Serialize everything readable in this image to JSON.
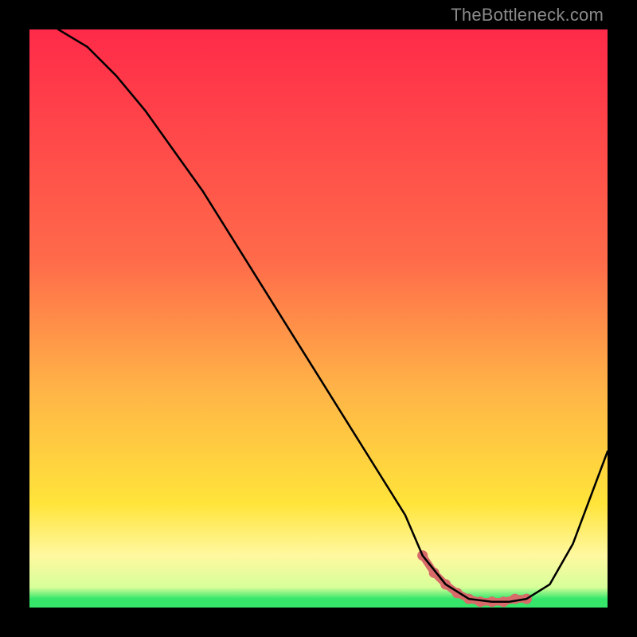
{
  "watermark": "TheBottleneck.com",
  "colors": {
    "band_red": "#ff2a49",
    "band_top_mid": "#ff6b4a",
    "band_mid": "#ffb347",
    "band_yellow": "#ffe43a",
    "band_pale": "#fff8a0",
    "band_green": "#35e66a",
    "curve": "#000000",
    "marker": "#d86a6a",
    "marker_stroke": "#d86a6a"
  },
  "chart_data": {
    "type": "line",
    "title": "",
    "xlabel": "",
    "ylabel": "",
    "xlim": [
      0,
      100
    ],
    "ylim": [
      0,
      100
    ],
    "series": [
      {
        "name": "bottleneck-curve",
        "x": [
          5,
          10,
          15,
          20,
          25,
          30,
          35,
          40,
          45,
          50,
          55,
          60,
          65,
          68,
          72,
          76,
          80,
          83,
          86,
          90,
          94,
          100
        ],
        "values": [
          100,
          97,
          92,
          86,
          79,
          72,
          64,
          56,
          48,
          40,
          32,
          24,
          16,
          9,
          4,
          1.5,
          1,
          1,
          1.5,
          4,
          11,
          27
        ]
      }
    ],
    "markers": {
      "name": "highlight-range",
      "x": [
        68,
        70,
        72,
        74,
        76,
        78,
        80,
        82,
        84,
        86
      ],
      "values": [
        9,
        6,
        4,
        2.5,
        1.5,
        1,
        1,
        1,
        1.5,
        1.5
      ]
    },
    "background_bands": [
      {
        "from_y": 100,
        "to_y": 45,
        "color_top": "#ff2a49",
        "color_bottom": "#ff6b4a"
      },
      {
        "from_y": 45,
        "to_y": 20,
        "color_top": "#ff6b4a",
        "color_bottom": "#ffe43a"
      },
      {
        "from_y": 20,
        "to_y": 8,
        "color_top": "#ffe43a",
        "color_bottom": "#fff8a0"
      },
      {
        "from_y": 8,
        "to_y": 2,
        "color_top": "#fff8a0",
        "color_bottom": "#c9ff9a"
      },
      {
        "from_y": 2,
        "to_y": 0,
        "color_top": "#35e66a",
        "color_bottom": "#35e66a"
      }
    ]
  }
}
